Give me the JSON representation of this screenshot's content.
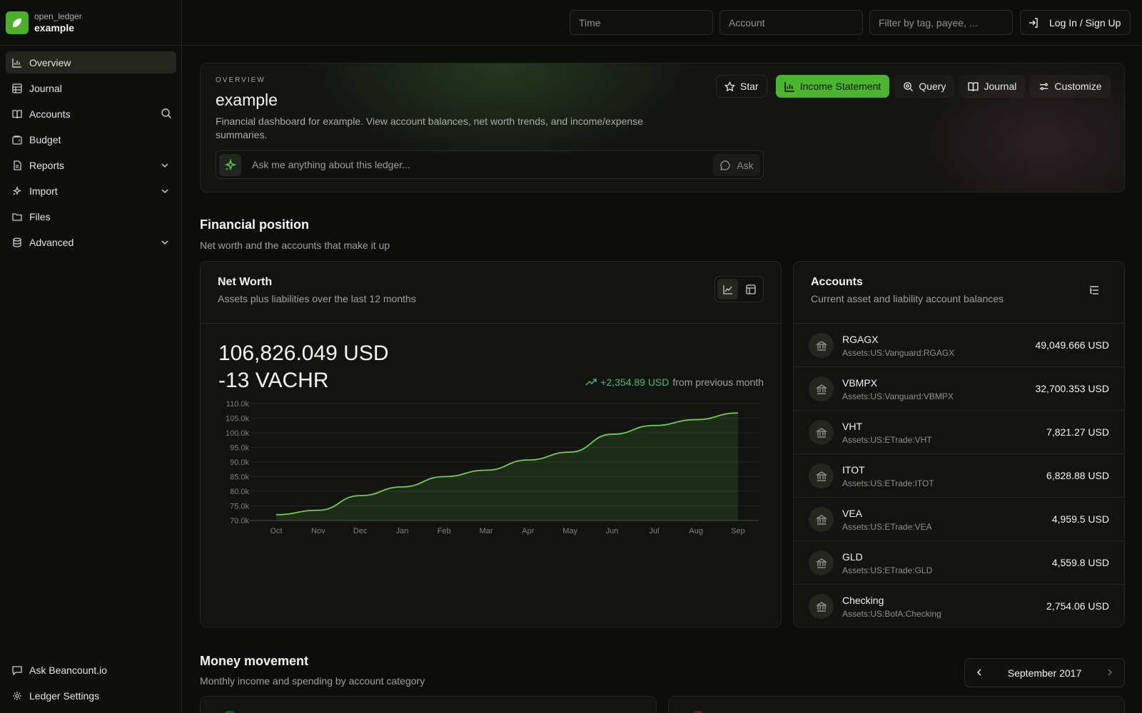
{
  "brand": {
    "org": "open_ledger",
    "ledger": "example",
    "accent": "#4caf2c"
  },
  "sidebar": {
    "items": [
      {
        "label": "Overview",
        "icon": "bar-chart-icon",
        "active": true
      },
      {
        "label": "Journal",
        "icon": "table-icon"
      },
      {
        "label": "Accounts",
        "icon": "book-open-icon",
        "search": true
      },
      {
        "label": "Budget",
        "icon": "wallet-icon"
      },
      {
        "label": "Reports",
        "icon": "report-icon",
        "expandable": true
      },
      {
        "label": "Import",
        "icon": "sparkle-icon",
        "expandable": true
      },
      {
        "label": "Files",
        "icon": "folder-icon"
      },
      {
        "label": "Advanced",
        "icon": "database-icon",
        "expandable": true
      }
    ],
    "bottom": [
      {
        "label": "Ask Beancount.io",
        "icon": "message-icon"
      },
      {
        "label": "Ledger Settings",
        "icon": "gear-icon"
      }
    ]
  },
  "topbar": {
    "time_placeholder": "Time",
    "account_placeholder": "Account",
    "filter_placeholder": "Filter by tag, payee, ...",
    "login_label": "Log In / Sign Up"
  },
  "hero": {
    "eyebrow": "OVERVIEW",
    "title": "example",
    "description": "Financial dashboard for example. View account balances, net worth trends, and income/expense summaries.",
    "ask_placeholder": "Ask me anything about this ledger...",
    "ask_button": "Ask",
    "actions": {
      "star": "Star",
      "income_statement": "Income Statement",
      "query": "Query",
      "journal": "Journal",
      "customize": "Customize"
    }
  },
  "financial_position": {
    "title": "Financial position",
    "subtitle": "Net worth and the accounts that make it up"
  },
  "net_worth": {
    "title": "Net Worth",
    "subtitle": "Assets plus liabilities over the last 12 months",
    "value_usd": "106,826.049 USD",
    "value_vachr": "-13 VACHR",
    "change_amount": "+2,354.89 USD",
    "change_text": "from previous month",
    "change_color": "#39c072"
  },
  "chart_data": {
    "type": "area",
    "title": "",
    "xlabel": "",
    "ylabel": "",
    "categories": [
      "Oct",
      "Nov",
      "Dec",
      "Jan",
      "Feb",
      "Mar",
      "Apr",
      "May",
      "Jun",
      "Jul",
      "Aug",
      "Sep"
    ],
    "series": [
      {
        "values": [
          72000,
          73500,
          78500,
          81500,
          85000,
          87200,
          90700,
          93400,
          99500,
          102500,
          104500,
          106800
        ]
      }
    ],
    "ylim": [
      70000,
      110000
    ],
    "yticks": [
      "70.0k",
      "75.0k",
      "80.0k",
      "85.0k",
      "90.0k",
      "95.0k",
      "100.0k",
      "105.0k",
      "110.0k"
    ],
    "grid": true,
    "legend": "none",
    "line_color": "#6fd04a"
  },
  "accounts": {
    "title": "Accounts",
    "subtitle": "Current asset and liability account balances",
    "rows": [
      {
        "name": "RGAGX",
        "path": "Assets:US:Vanguard:RGAGX",
        "balance": "49,049.666 USD"
      },
      {
        "name": "VBMPX",
        "path": "Assets:US:Vanguard:VBMPX",
        "balance": "32,700.353 USD"
      },
      {
        "name": "VHT",
        "path": "Assets:US:ETrade:VHT",
        "balance": "7,821.27 USD"
      },
      {
        "name": "ITOT",
        "path": "Assets:US:ETrade:ITOT",
        "balance": "6,828.88 USD"
      },
      {
        "name": "VEA",
        "path": "Assets:US:ETrade:VEA",
        "balance": "4,959.5 USD"
      },
      {
        "name": "GLD",
        "path": "Assets:US:ETrade:GLD",
        "balance": "4,559.8 USD"
      },
      {
        "name": "Checking",
        "path": "Assets:US:BofA:Checking",
        "balance": "2,754.06 USD"
      }
    ]
  },
  "money_movement": {
    "title": "Money movement",
    "subtitle": "Monthly income and spending by account category",
    "month": "September 2017"
  }
}
